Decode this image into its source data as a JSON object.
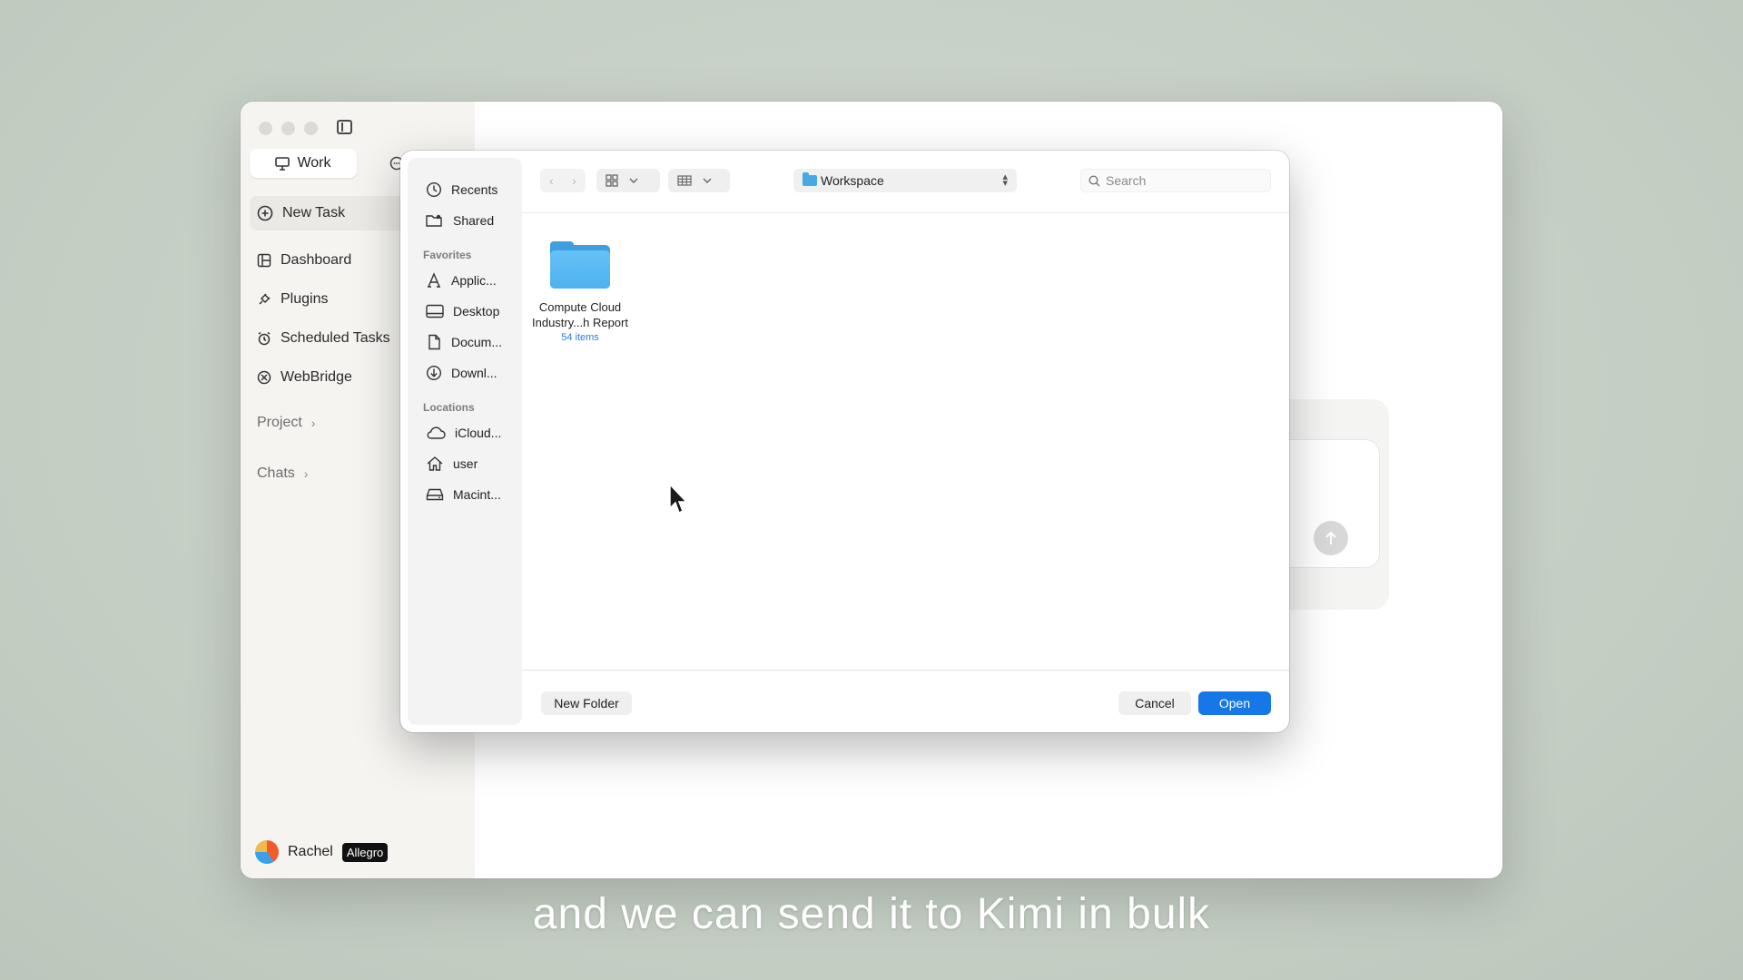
{
  "app": {
    "mode_tabs": {
      "work": "Work"
    },
    "nav": {
      "new_task": "New Task",
      "items": [
        {
          "label": "Dashboard",
          "icon": "dashboard-icon"
        },
        {
          "label": "Plugins",
          "icon": "plug-icon"
        },
        {
          "label": "Scheduled Tasks",
          "icon": "alarm-clock-icon"
        },
        {
          "label": "WebBridge",
          "icon": "webbridge-icon"
        }
      ],
      "groups": [
        "Project",
        "Chats"
      ]
    },
    "user": {
      "name": "Rachel",
      "plan": "Allegro"
    }
  },
  "dialog": {
    "sidebar": {
      "top": [
        {
          "label": "Recents",
          "icon": "clock-icon"
        },
        {
          "label": "Shared",
          "icon": "shared-folder-icon"
        }
      ],
      "favorites_title": "Favorites",
      "favorites": [
        {
          "label": "Applic...",
          "icon": "applications-icon"
        },
        {
          "label": "Desktop",
          "icon": "desktop-icon"
        },
        {
          "label": "Docum...",
          "icon": "document-icon"
        },
        {
          "label": "Downl...",
          "icon": "download-icon"
        }
      ],
      "locations_title": "Locations",
      "locations": [
        {
          "label": "iCloud...",
          "icon": "cloud-icon"
        },
        {
          "label": "user",
          "icon": "home-icon"
        },
        {
          "label": "Macint...",
          "icon": "hard-drive-icon"
        }
      ]
    },
    "location": "Workspace",
    "search_placeholder": "Search",
    "files": [
      {
        "name_line1": "Compute Cloud",
        "name_line2": "Industry...h Report",
        "count": "54 items"
      }
    ],
    "buttons": {
      "new_folder": "New Folder",
      "cancel": "Cancel",
      "open": "Open"
    }
  },
  "subtitle": "and we can send it to Kimi in bulk",
  "colors": {
    "accent": "#1677e8",
    "folder": "#4db2ef",
    "background": "#c9d2c8"
  }
}
